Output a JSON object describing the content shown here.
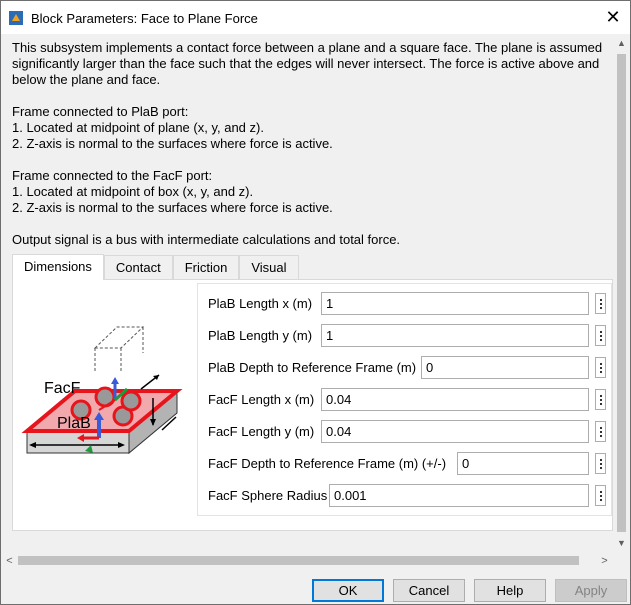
{
  "window": {
    "title": "Block Parameters: Face to Plane Force",
    "close_glyph": "✕"
  },
  "description": {
    "para1": "This subsystem implements a contact force between a plane and a square face. The plane is assumed significantly larger than the face such that the edges will never intersect.  The force is active above and below the plane and face.",
    "plab_heading": "Frame connected to PlaB port:",
    "plab_line1": "1. Located at midpoint of plane (x, y, and z).",
    "plab_line2": "2. Z-axis is normal to the surfaces where force is active.",
    "facf_heading": "Frame connected to the FacF port:",
    "facf_line1": "1. Located at midpoint of box (x, y, and z).",
    "facf_line2": "2. Z-axis is normal to the surfaces where force is active.",
    "output": "Output signal is a bus with intermediate calculations and total force."
  },
  "tabs": [
    {
      "label": "Dimensions",
      "active": true
    },
    {
      "label": "Contact",
      "active": false
    },
    {
      "label": "Friction",
      "active": false
    },
    {
      "label": "Visual",
      "active": false
    }
  ],
  "diagram": {
    "facf_label": "FacF",
    "plab_label": "PlaB",
    "colors": {
      "plane_edge": "#e8141c",
      "axis_blue": "#3a5bd8",
      "axis_green": "#1f9a3a"
    }
  },
  "parameters": [
    {
      "label": "PlaB Length x (m)",
      "value": "1"
    },
    {
      "label": "PlaB Length y (m)",
      "value": "1"
    },
    {
      "label": "PlaB Depth to Reference Frame (m)",
      "value": "0"
    },
    {
      "label": "FacF Length x (m)",
      "value": "0.04"
    },
    {
      "label": "FacF Length y (m)",
      "value": "0.04"
    },
    {
      "label": "FacF Depth to Reference Frame (m) (+/-)",
      "value": "0"
    },
    {
      "label": "FacF Sphere Radius",
      "value": "0.001"
    }
  ],
  "scrollbars": {
    "up_glyph": "▲",
    "down_glyph": "▼",
    "left_glyph": "<",
    "right_glyph": ">"
  },
  "buttons": {
    "ok": "OK",
    "cancel": "Cancel",
    "help": "Help",
    "apply": "Apply"
  }
}
